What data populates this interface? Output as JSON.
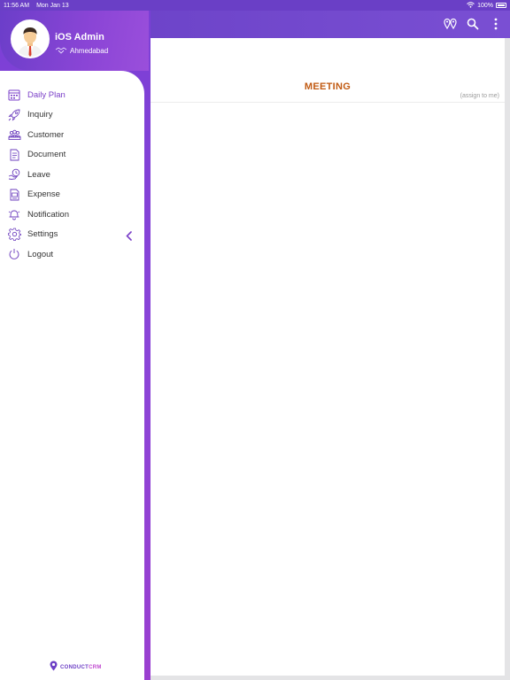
{
  "status_bar": {
    "time": "11:56 AM",
    "date": "Mon Jan 13",
    "battery": "100%"
  },
  "user": {
    "name": "iOS Admin",
    "location": "Ahmedabad"
  },
  "menu": [
    {
      "label": "Daily Plan",
      "icon": "calendar-icon",
      "active": true
    },
    {
      "label": "Inquiry",
      "icon": "rocket-icon"
    },
    {
      "label": "Customer",
      "icon": "customers-icon"
    },
    {
      "label": "Document",
      "icon": "document-icon"
    },
    {
      "label": "Leave",
      "icon": "leave-icon"
    },
    {
      "label": "Expense",
      "icon": "expense-icon"
    },
    {
      "label": "Notification",
      "icon": "bell-icon"
    },
    {
      "label": "Settings",
      "icon": "gear-icon"
    },
    {
      "label": "Logout",
      "icon": "power-icon"
    }
  ],
  "main": {
    "title": "MEETING",
    "assign_note": "(assign to me)"
  },
  "brand": {
    "part1": "CONDUCT",
    "part2": "CRM"
  },
  "colors": {
    "accent": "#7a3fc8",
    "title": "#c15a12"
  }
}
